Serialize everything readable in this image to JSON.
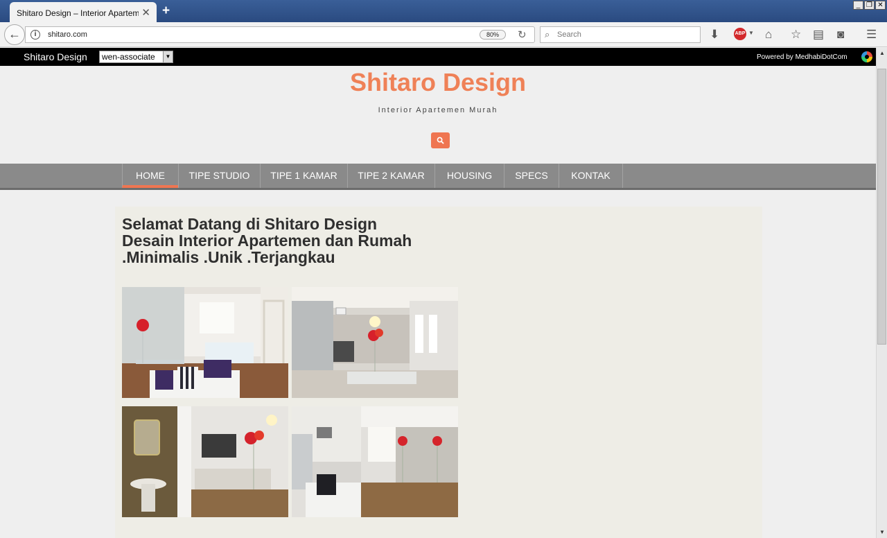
{
  "browser": {
    "tab_title": "Shitaro Design – Interior Apartemen",
    "tab_close": "✕",
    "new_tab": "+",
    "url": "shitaro.com",
    "zoom": "80%",
    "search_placeholder": "Search",
    "abp_label": "ABP"
  },
  "topbar": {
    "brand": "Shitaro Design",
    "select_value": "wen-associate",
    "powered_by": "Powered by MedhabiDotCom"
  },
  "header": {
    "title": "Shitaro Design",
    "tagline": "Interior Apartemen Murah"
  },
  "menu": {
    "items": [
      "HOME",
      "TIPE STUDIO",
      "TIPE 1 KAMAR",
      "TIPE 2 KAMAR",
      "HOUSING",
      "SPECS",
      "KONTAK"
    ],
    "active": "HOME"
  },
  "main": {
    "welcome_line1": "Selamat Datang di Shitaro Design",
    "welcome_line2": "Desain Interior Apartemen dan Rumah",
    "welcome_line3": ".Minimalis .Unik .Terjangkau"
  },
  "icons": {
    "back": "back-arrow-icon",
    "info": "info-icon",
    "reload": "reload-icon",
    "search": "search-icon",
    "download": "download-icon",
    "home": "home-icon",
    "bookmark": "star-icon",
    "reader": "reading-list-icon",
    "pocket": "pocket-icon",
    "menu": "hamburger-menu-icon"
  },
  "colors": {
    "brand_orange": "#ef8157",
    "menu_bg": "#8a8a8a",
    "content_bg": "#eeede6"
  }
}
